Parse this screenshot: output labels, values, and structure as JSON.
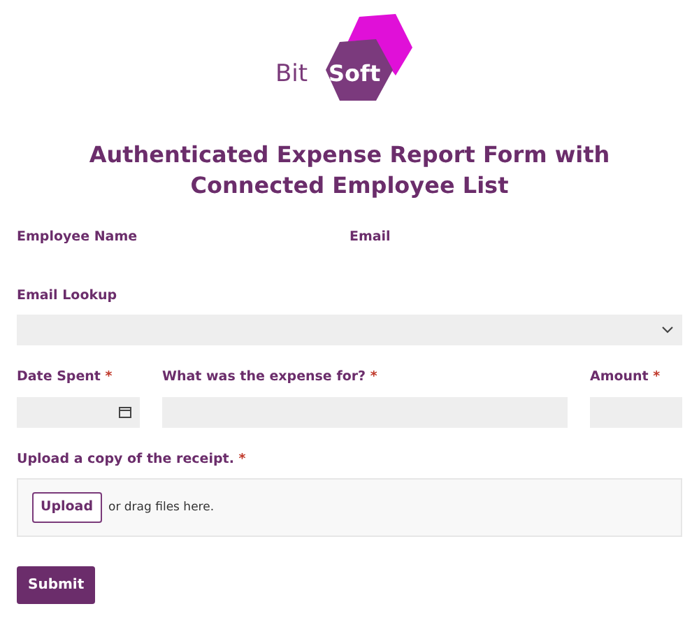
{
  "logo": {
    "text_1": "Bit",
    "text_2": "Soft"
  },
  "title": "Authenticated Expense Report Form with Connected Employee List",
  "info_fields": [
    {
      "label": "Employee Name"
    },
    {
      "label": "Email"
    }
  ],
  "lookup": {
    "label": "Email Lookup"
  },
  "row_fields": [
    {
      "kind": "date",
      "label": "Date Spent",
      "required_mark": "*"
    },
    {
      "kind": "text",
      "label": "What was the expense for?",
      "required_mark": "*"
    },
    {
      "kind": "text",
      "label": "Amount",
      "required_mark": "*"
    }
  ],
  "upload": {
    "label": "Upload a copy of the receipt.",
    "required_mark": "*",
    "button": "Upload",
    "hint": "or drag files here."
  },
  "submit": "Submit"
}
